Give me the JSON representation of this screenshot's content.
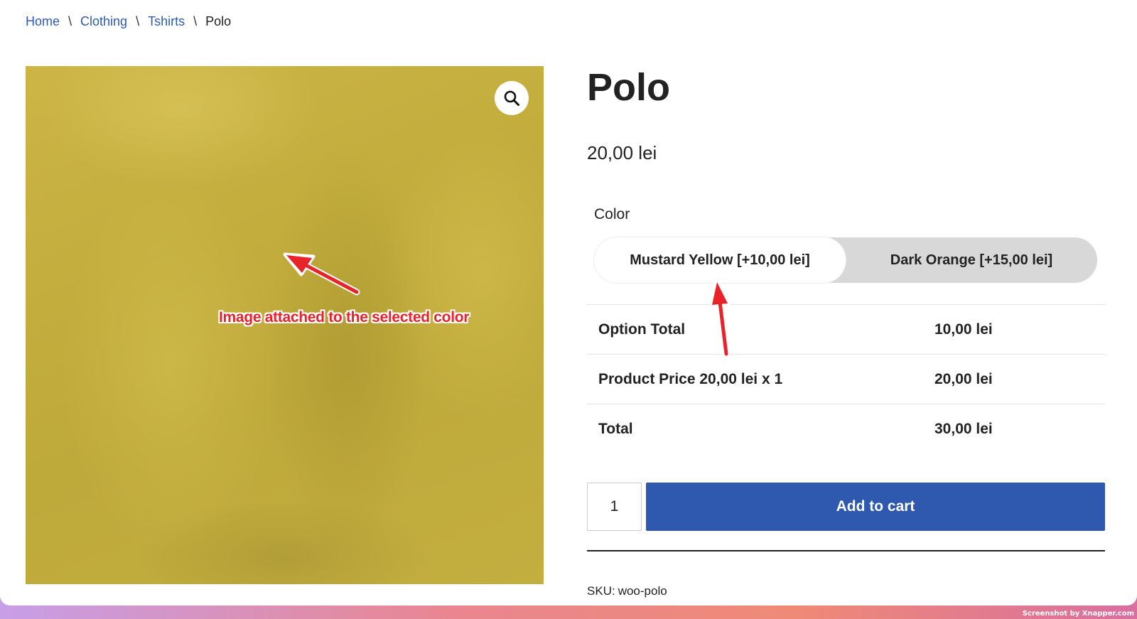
{
  "breadcrumb": {
    "items": [
      "Home",
      "Clothing",
      "Tshirts"
    ],
    "current": "Polo",
    "separator": "\\"
  },
  "product": {
    "title": "Polo",
    "price": "20,00 lei",
    "image_color": "#c4ae3f"
  },
  "color_picker": {
    "label": "Color",
    "options": [
      {
        "label": "Mustard Yellow [+10,00 lei]",
        "selected": true
      },
      {
        "label": "Dark Orange [+15,00 lei]",
        "selected": false
      }
    ]
  },
  "totals": [
    {
      "label": "Option Total",
      "value": "10,00 lei"
    },
    {
      "label": "Product Price 20,00 lei x 1",
      "value": "20,00 lei"
    },
    {
      "label": "Total",
      "value": "30,00 lei"
    }
  ],
  "cart": {
    "quantity": "1",
    "add_label": "Add to cart",
    "button_color": "#2e59ae"
  },
  "sku": {
    "label": "SKU:",
    "value": "woo-polo"
  },
  "annotation": {
    "text": "Image attached to the selected color",
    "color": "#e8232a"
  },
  "watermark": "Screenshot by Xnapper.com",
  "icons": {
    "zoom": "search-icon"
  }
}
